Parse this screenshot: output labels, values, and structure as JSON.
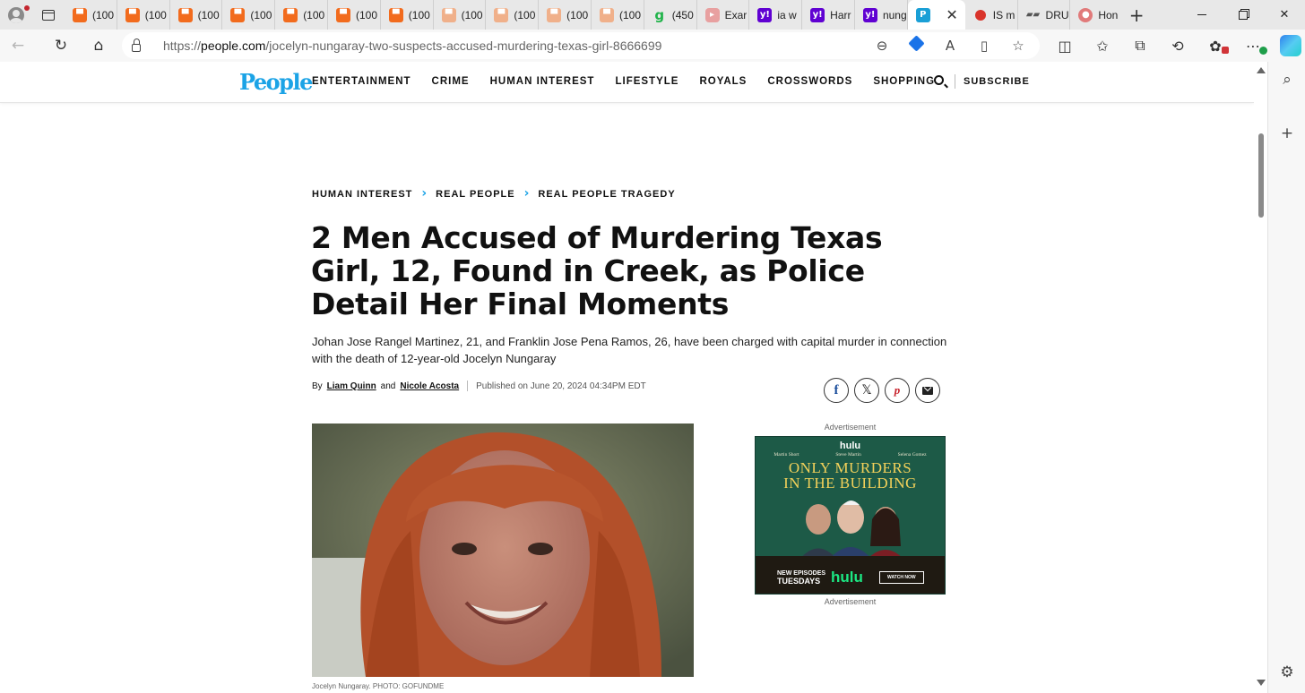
{
  "browser": {
    "tabs": [
      {
        "label": "(100",
        "icon": "substack-icon",
        "style": "sub"
      },
      {
        "label": "(100",
        "icon": "substack-icon",
        "style": "sub"
      },
      {
        "label": "(100",
        "icon": "substack-icon",
        "style": "sub"
      },
      {
        "label": "(100",
        "icon": "substack-icon",
        "style": "sub"
      },
      {
        "label": "(100",
        "icon": "substack-icon",
        "style": "sub"
      },
      {
        "label": "(100",
        "icon": "substack-icon",
        "style": "sub"
      },
      {
        "label": "(100",
        "icon": "substack-icon",
        "style": "sub"
      },
      {
        "label": "(100",
        "icon": "substack-icon",
        "style": "sub-faded"
      },
      {
        "label": "(100",
        "icon": "substack-icon",
        "style": "sub-faded"
      },
      {
        "label": "(100",
        "icon": "substack-icon",
        "style": "sub-faded"
      },
      {
        "label": "(100",
        "icon": "substack-icon",
        "style": "sub-faded"
      },
      {
        "label": "(450",
        "icon": "g-icon",
        "style": "g"
      },
      {
        "label": "Exar",
        "icon": "youtube-icon",
        "style": "yt"
      },
      {
        "label": "ia w",
        "icon": "yahoo-icon",
        "style": "y"
      },
      {
        "label": "Harr",
        "icon": "yahoo-icon",
        "style": "y"
      },
      {
        "label": "nung",
        "icon": "yahoo-icon",
        "style": "y"
      },
      {
        "label": "",
        "icon": "people-icon",
        "style": "p",
        "active": true
      },
      {
        "label": "IS m",
        "icon": "stop-icon",
        "style": "stop"
      },
      {
        "label": "DRU",
        "icon": "dru-icon",
        "style": "dr"
      },
      {
        "label": "Hon",
        "icon": "hon-icon",
        "style": "hon"
      }
    ],
    "url_domain": "people.com",
    "url_prefix": "https://",
    "url_path": "/jocelyn-nungaray-two-suspects-accused-murdering-texas-girl-8666699"
  },
  "site": {
    "logo": "People",
    "nav": [
      "ENTERTAINMENT",
      "CRIME",
      "HUMAN INTEREST",
      "LIFESTYLE",
      "ROYALS",
      "CROSSWORDS",
      "SHOPPING"
    ],
    "subscribe": "SUBSCRIBE"
  },
  "article": {
    "breadcrumb": [
      "HUMAN INTEREST",
      "REAL PEOPLE",
      "REAL PEOPLE TRAGEDY"
    ],
    "headline": "2 Men Accused of Murdering Texas Girl, 12, Found in Creek, as Police Detail Her Final Moments",
    "dek": "Johan Jose Rangel Martinez, 21, and Franklin Jose Pena Ramos, 26, have been charged with capital murder in connection with the death of 12-year-old Jocelyn Nungaray",
    "by": "By",
    "author1": "Liam Quinn",
    "and": "and",
    "author2": "Nicole Acosta",
    "published": "Published on June 20, 2024 04:34PM EDT",
    "caption": "Jocelyn Nungaray. PHOTO: GOFUNDME"
  },
  "ad": {
    "label_top": "Advertisement",
    "label_bottom": "Advertisement",
    "brand": "hulu",
    "cast": [
      "Martin Short",
      "Steve Martin",
      "Selena Gomez"
    ],
    "title_line1": "ONLY MURDERS",
    "title_line2": "IN THE BUILDING",
    "new_episodes": "NEW EPISODES",
    "day": "TUESDAYS",
    "watch": "WATCH NOW"
  },
  "colors": {
    "accent": "#1ba3e6",
    "headline": "#111111"
  }
}
